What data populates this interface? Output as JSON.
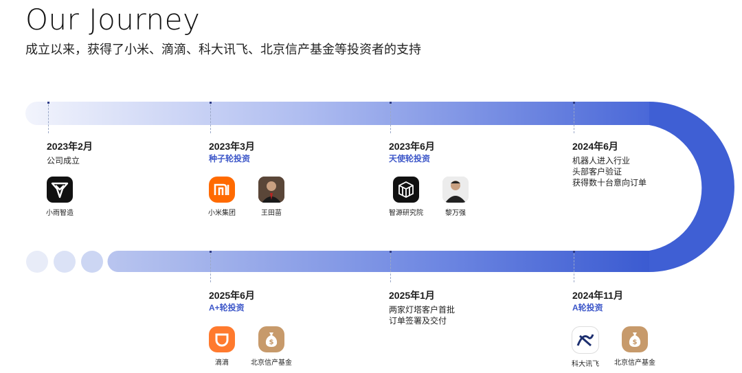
{
  "header": {
    "title": "Our Journey",
    "subtitle": "成立以来，获得了小米、滴滴、科大讯飞、北京信产基金等投资者的支持"
  },
  "milestones": [
    {
      "date": "2023年2月",
      "tag": "",
      "desc": "公司成立",
      "logos": [
        {
          "name": "小雨智造",
          "icon": "xiaoyu-logo-icon"
        }
      ]
    },
    {
      "date": "2023年3月",
      "tag": "种子轮投资",
      "desc": "",
      "logos": [
        {
          "name": "小米集团",
          "icon": "xiaomi-logo-icon"
        },
        {
          "name": "王田苗",
          "icon": "person-photo-icon"
        }
      ]
    },
    {
      "date": "2023年6月",
      "tag": "天使轮投资",
      "desc": "",
      "logos": [
        {
          "name": "智源研究院",
          "icon": "baai-logo-icon"
        },
        {
          "name": "黎万强",
          "icon": "person-photo-icon"
        }
      ]
    },
    {
      "date": "2024年6月",
      "tag": "",
      "desc": [
        "机器人进入行业",
        "头部客户验证",
        "获得数十台意向订单"
      ],
      "logos": []
    },
    {
      "date": "2025年6月",
      "tag": "A+轮投资",
      "desc": "",
      "logos": [
        {
          "name": "滴滴",
          "icon": "didi-logo-icon"
        },
        {
          "name": "北京信产基金",
          "icon": "money-bag-icon"
        }
      ]
    },
    {
      "date": "2025年1月",
      "tag": "",
      "desc": [
        "两家灯塔客户首批",
        "订单签署及交付"
      ],
      "logos": []
    },
    {
      "date": "2024年11月",
      "tag": "A轮投资",
      "desc": "",
      "logos": [
        {
          "name": "科大讯飞",
          "icon": "iflytek-logo-icon"
        },
        {
          "name": "北京信产基金",
          "icon": "money-bag-icon"
        }
      ]
    }
  ],
  "colors": {
    "track_start": "#eef1fb",
    "track_end": "#3b5bd1",
    "accent": "#3d57c9",
    "xiaomi": "#ff6a00",
    "didi": "#ff7a2e",
    "bag": "#c79a6b"
  }
}
